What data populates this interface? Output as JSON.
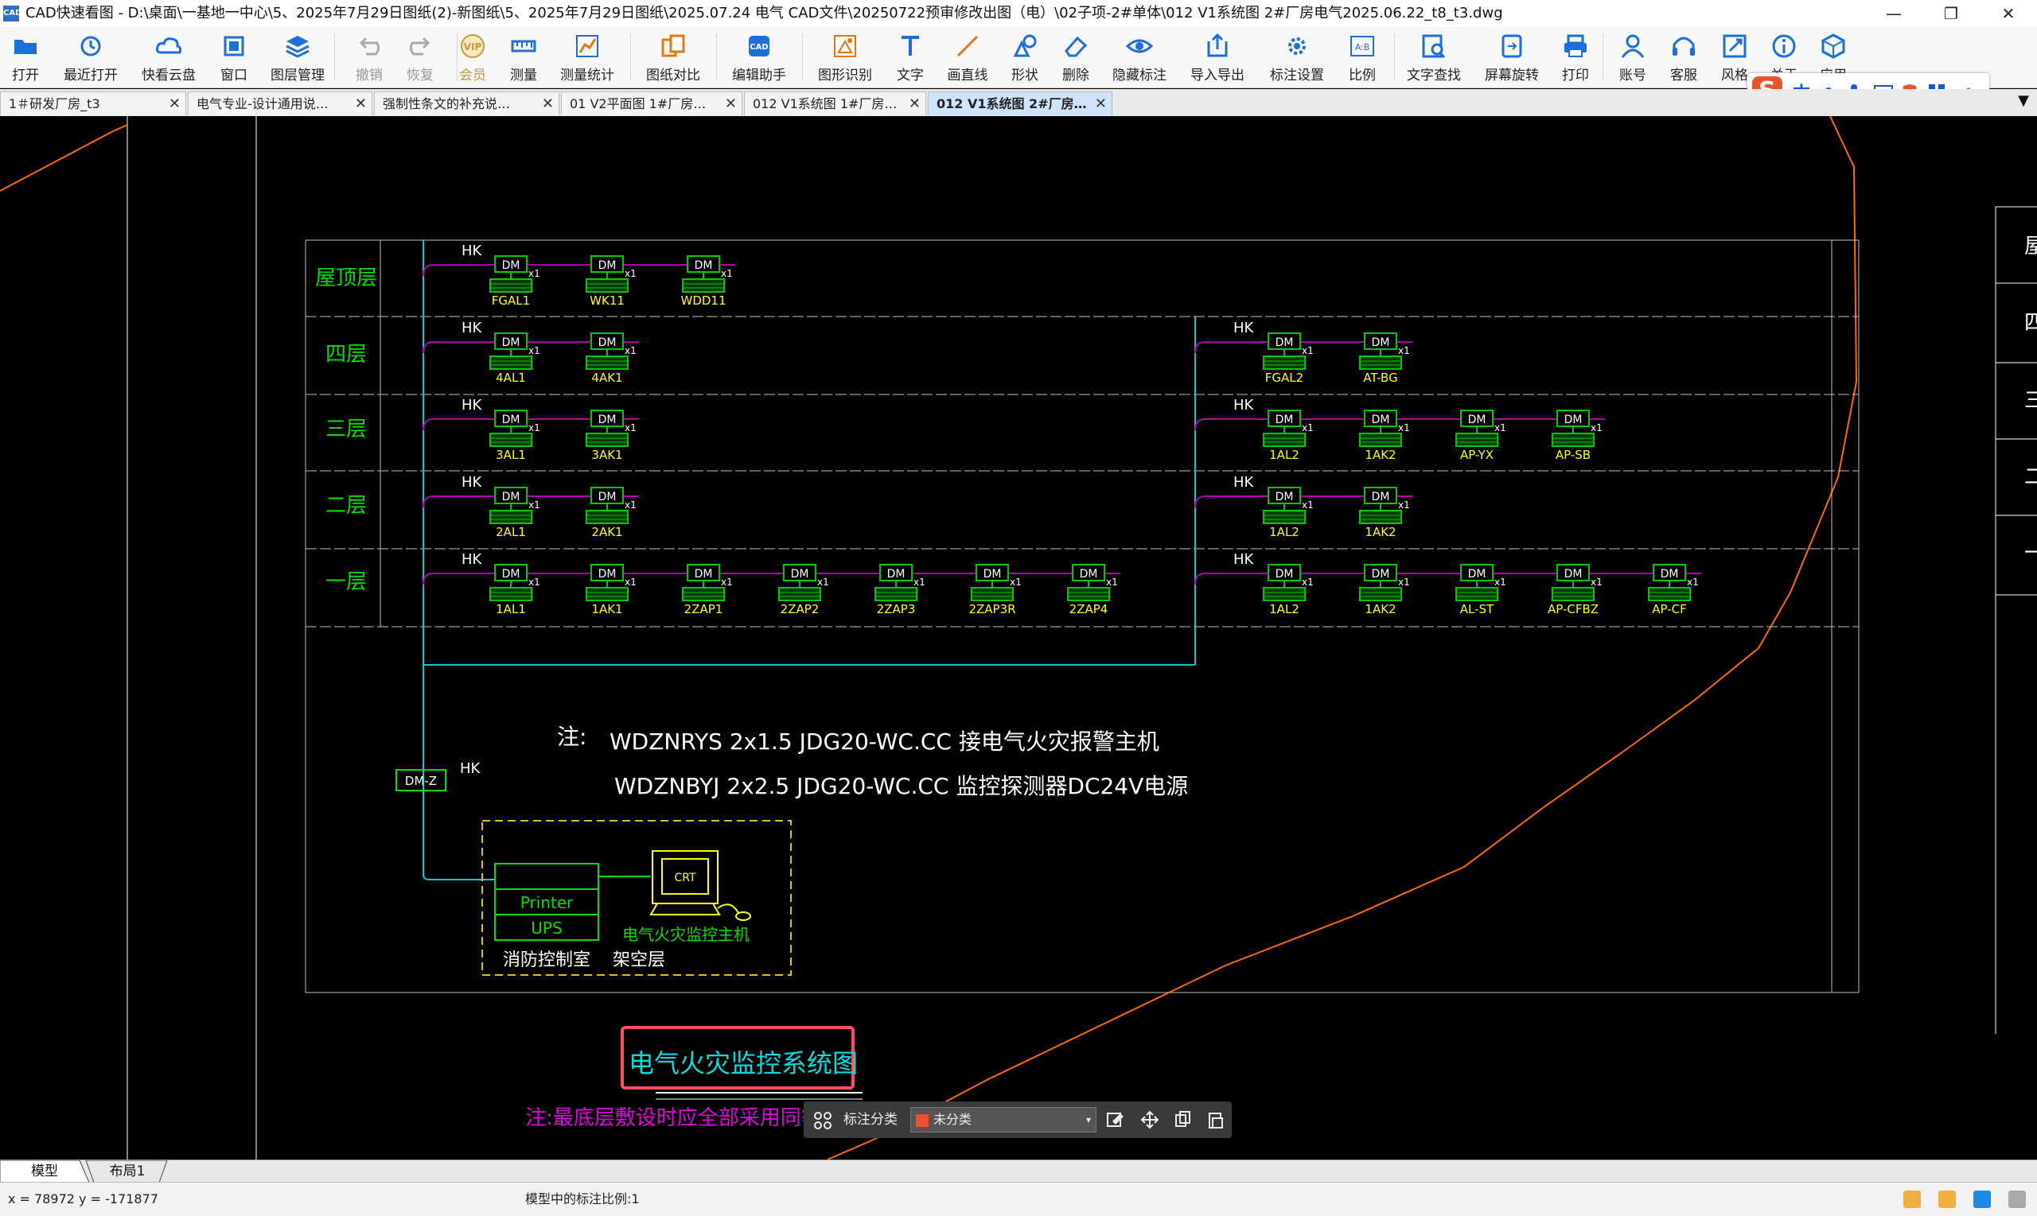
{
  "app": {
    "logo_text": "CAD",
    "title": "CAD快速看图 - D:\\桌面\\一基地一中心\\5、2025年7月29日图纸(2)-新图纸\\5、2025年7月29日图纸\\2025.07.24 电气 CAD文件\\20250722预审修改出图（电）\\02子项-2#单体\\012 V1系统图 2#厂房电气2025.06.22_t8_t3.dwg",
    "min": "—",
    "restore": "❐",
    "close": "✕"
  },
  "toolbar": [
    {
      "id": "open",
      "label": "打开",
      "icon": "folder-icon",
      "color": "#1e6fd9"
    },
    {
      "id": "recent",
      "label": "最近打开",
      "icon": "history-icon",
      "color": "#1e6fd9"
    },
    {
      "id": "cloud",
      "label": "快看云盘",
      "icon": "cloud-icon",
      "color": "#1e6fd9"
    },
    {
      "id": "window",
      "label": "窗口",
      "icon": "window-icon",
      "color": "#1e6fd9"
    },
    {
      "id": "layers",
      "label": "图层管理",
      "icon": "layers-icon",
      "color": "#1e6fd9"
    },
    {
      "id": "undo",
      "label": "撤销",
      "icon": "undo-icon",
      "color": "#aaaaaa",
      "disabled": true
    },
    {
      "id": "redo",
      "label": "恢复",
      "icon": "redo-icon",
      "color": "#aaaaaa",
      "disabled": true
    },
    {
      "id": "vip",
      "label": "会员",
      "icon": "vip-icon",
      "color": "#c89a3a",
      "vip": true
    },
    {
      "id": "measure",
      "label": "测量",
      "icon": "ruler-icon",
      "color": "#1e6fd9"
    },
    {
      "id": "measure_stats",
      "label": "测量统计",
      "icon": "stats-icon",
      "color": "#1e6fd9"
    },
    {
      "id": "compare",
      "label": "图纸对比",
      "icon": "compare-icon",
      "color": "#e07a10"
    },
    {
      "id": "edit_assist",
      "label": "编辑助手",
      "icon": "cad-edit-icon",
      "color": "#1e6fd9"
    },
    {
      "id": "shape_recog",
      "label": "图形识别",
      "icon": "shape-recognize-icon",
      "color": "#e07a10"
    },
    {
      "id": "text",
      "label": "文字",
      "icon": "text-icon",
      "color": "#1e6fd9"
    },
    {
      "id": "line",
      "label": "画直线",
      "icon": "line-icon",
      "color": "#e07a10"
    },
    {
      "id": "shape",
      "label": "形状",
      "icon": "shape-icon",
      "color": "#1e6fd9"
    },
    {
      "id": "delete",
      "label": "删除",
      "icon": "eraser-icon",
      "color": "#1e6fd9"
    },
    {
      "id": "hide_ann",
      "label": "隐藏标注",
      "icon": "eye-icon",
      "color": "#1e6fd9"
    },
    {
      "id": "import_export",
      "label": "导入导出",
      "icon": "export-icon",
      "color": "#1e6fd9"
    },
    {
      "id": "ann_settings",
      "label": "标注设置",
      "icon": "settings-icon",
      "color": "#1e6fd9"
    },
    {
      "id": "scale",
      "label": "比例",
      "icon": "scale-icon",
      "color": "#1e6fd9"
    },
    {
      "id": "text_search",
      "label": "文字查找",
      "icon": "text-search-icon",
      "color": "#1e6fd9"
    },
    {
      "id": "rotate",
      "label": "屏幕旋转",
      "icon": "rotate-icon",
      "color": "#1e6fd9"
    },
    {
      "id": "print",
      "label": "打印",
      "icon": "printer-icon",
      "color": "#1e6fd9"
    },
    {
      "id": "account",
      "label": "账号",
      "icon": "user-icon",
      "color": "#1e6fd9"
    },
    {
      "id": "service",
      "label": "客服",
      "icon": "headset-icon",
      "color": "#1e6fd9"
    },
    {
      "id": "style",
      "label": "风格",
      "icon": "style-icon",
      "color": "#1e6fd9"
    },
    {
      "id": "about",
      "label": "关于",
      "icon": "info-icon",
      "color": "#1e6fd9"
    },
    {
      "id": "apps",
      "label": "应用",
      "icon": "cube-icon",
      "color": "#1e6fd9"
    }
  ],
  "ime": {
    "logo": "S",
    "lang": "中"
  },
  "tabs": [
    {
      "label": "1＃研发厂房_t3"
    },
    {
      "label": "电气专业-设计通用说…"
    },
    {
      "label": "强制性条文的补充说…"
    },
    {
      "label": "01 V2平面图 1#厂房…"
    },
    {
      "label": "012 V1系统图 1#厂房…"
    },
    {
      "label": "012 V1系统图 2#厂房…",
      "active": true
    }
  ],
  "tab_more": "▼",
  "drawing": {
    "colors": {
      "frame": "#ffffff",
      "grid": "#bfbfbf",
      "floor_label": "#00e000",
      "module_box": "#00c800",
      "module_text": "#ffffff",
      "hatch": "#00c800",
      "bus": "#b000b0",
      "riser": "#00cccc",
      "label": "#ffff00",
      "note": "#ffffff",
      "red_box": "#ff5060",
      "title_text": "#00dddd",
      "magenta_note": "#e000e0",
      "orange_curve": "#ff6a00",
      "yellow_dash": "#e0c000"
    },
    "floors": [
      "屋顶层",
      "四层",
      "三层",
      "二层",
      "一层"
    ],
    "bus_label": "HK",
    "module_tag": "DM",
    "multiplier": "x1",
    "left_rows": [
      [
        "FGAL1",
        "WK11",
        "WDD11"
      ],
      [
        "4AL1",
        "4AK1"
      ],
      [
        "3AL1",
        "3AK1"
      ],
      [
        "2AL1",
        "2AK1"
      ],
      [
        "1AL1",
        "1AK1",
        "2ZAP1",
        "2ZAP2",
        "2ZAP3",
        "2ZAP3R",
        "2ZAP4"
      ]
    ],
    "right_rows": [
      [],
      [
        "FGAL2",
        "AT-BG"
      ],
      [
        "1AL2",
        "1AK2",
        "AP-YX",
        "AP-SB"
      ],
      [
        "1AL2",
        "1AK2"
      ],
      [
        "1AL2",
        "1AK2",
        "AL-ST",
        "AP-CFBZ",
        "AP-CF"
      ]
    ],
    "note_prefix": "注:",
    "note_line1": "WDZNRYS 2x1.5 JDG20-WC.CC 接电气火灾报警主机",
    "note_line2": "WDZNBYJ 2x2.5 JDG20-WC.CC 监控探测器DC24V电源",
    "dmz_label": "DM-Z",
    "printer_label": "Printer",
    "ups_label": "UPS",
    "crt_label": "CRT",
    "host_label": "电气火灾监控主机",
    "room_label": "消防控制室",
    "floor_overhead": "架空层",
    "diagram_title": "电气火灾监控系统图",
    "bottom_note": "注:最底层敷设时应全部采用同等规格",
    "right_partial": [
      "屋",
      "四",
      "三",
      "二",
      "一"
    ]
  },
  "annot_bar": {
    "label": "标注分类",
    "value": "未分类",
    "swatch": "#e8532b",
    "arrow": "▾"
  },
  "bottom_tabs": [
    "模型",
    "布局1"
  ],
  "status": {
    "coords": "x = 78972  y = -171877",
    "scale_text": "模型中的标注比例:1"
  }
}
